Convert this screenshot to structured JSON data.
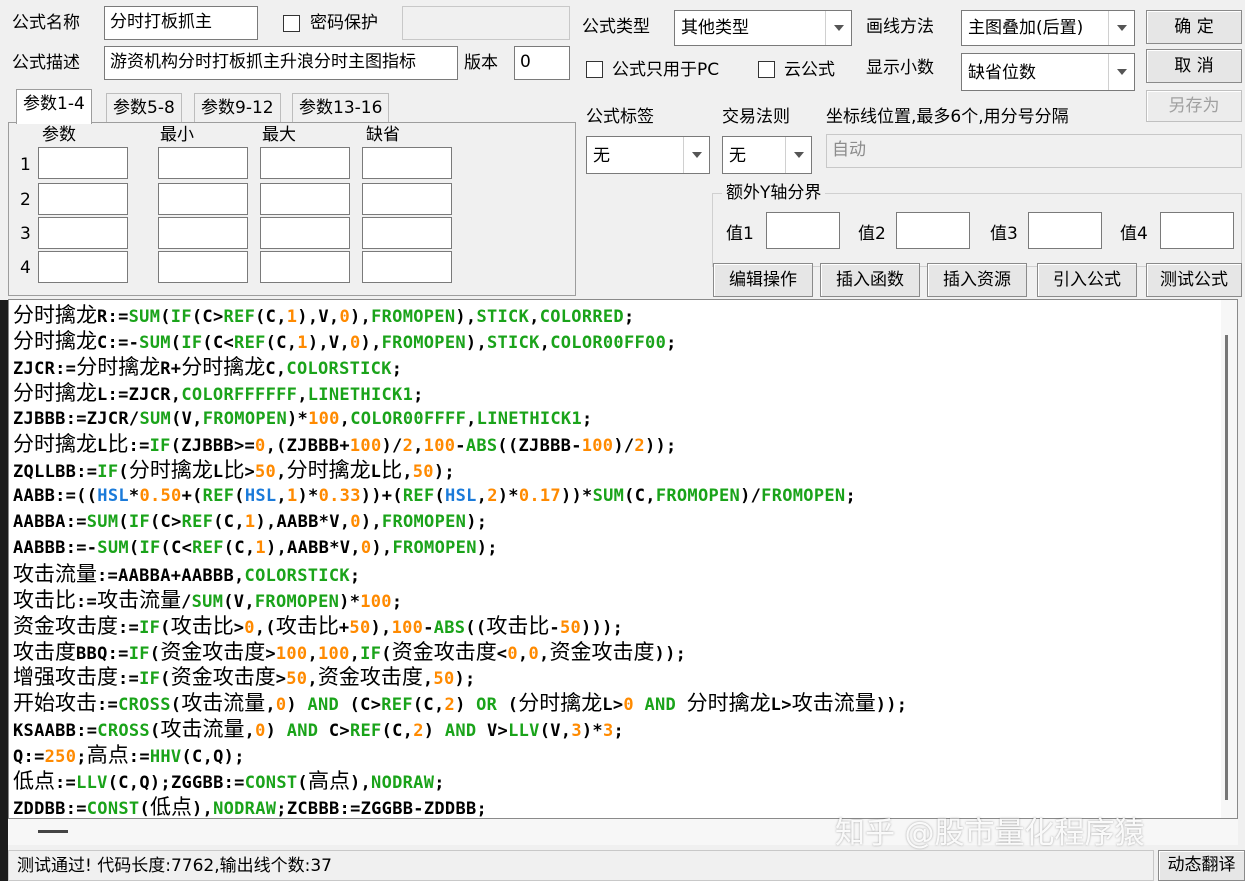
{
  "header": {
    "name_label": "公式名称",
    "name_value": "分时打板抓主",
    "password_label": "密码保护",
    "desc_label": "公式描述",
    "desc_value": "游资机构分时打板抓主升浪分时主图指标",
    "version_label": "版本",
    "version_value": "0",
    "type_label": "公式类型",
    "type_value": "其他类型",
    "draw_label": "画线方法",
    "draw_value": "主图叠加(后置)",
    "pc_only_label": "公式只用于PC",
    "cloud_label": "云公式",
    "decimals_label": "显示小数",
    "decimals_value": "缺省位数"
  },
  "buttons": {
    "ok": "确  定",
    "cancel": "取  消",
    "save_as": "另存为",
    "edit": "编辑操作",
    "insert_func": "插入函数",
    "insert_res": "插入资源",
    "import": "引入公式",
    "test": "测试公式",
    "dynamic_translate": "动态翻译"
  },
  "tabs": [
    "参数1-4",
    "参数5-8",
    "参数9-12",
    "参数13-16"
  ],
  "param_headers": [
    "参数",
    "最小",
    "最大",
    "缺省"
  ],
  "param_rows": [
    "1",
    "2",
    "3",
    "4"
  ],
  "tag": {
    "label": "公式标签",
    "value": "无"
  },
  "rule": {
    "label": "交易法则",
    "value": "无"
  },
  "coord": {
    "label": "坐标线位置,最多6个,用分号分隔",
    "placeholder": "自动"
  },
  "yaxis": {
    "label": "额外Y轴分界",
    "v1": "值1",
    "v2": "值2",
    "v3": "值3",
    "v4": "值4"
  },
  "code_lines": [
    "分时擒龙R:=SUM(IF(C>REF(C,1),V,0),FROMOPEN),STICK,COLORRED;",
    "分时擒龙C:=-SUM(IF(C<REF(C,1),V,0),FROMOPEN),STICK,COLOR00FF00;",
    "ZJCR:=分时擒龙R+分时擒龙C,COLORSTICK;",
    "分时擒龙L:=ZJCR,COLORFFFFFF,LINETHICK1;",
    "ZJBBB:=ZJCR/SUM(V,FROMOPEN)*100,COLOR00FFFF,LINETHICK1;",
    "分时擒龙L比:=IF(ZJBBB>=0,(ZJBBB+100)/2,100-ABS((ZJBBB-100)/2));",
    "ZQLLBB:=IF(分时擒龙L比>50,分时擒龙L比,50);",
    "AABB:=((HSL*0.50+(REF(HSL,1)*0.33))+(REF(HSL,2)*0.17))*SUM(C,FROMOPEN)/FROMOPEN;",
    "AABBA:=SUM(IF(C>REF(C,1),AABB*V,0),FROMOPEN);",
    "AABBB:=-SUM(IF(C<REF(C,1),AABB*V,0),FROMOPEN);",
    "攻击流量:=AABBA+AABBB,COLORSTICK;",
    "攻击比:=攻击流量/SUM(V,FROMOPEN)*100;",
    "资金攻击度:=IF(攻击比>0,(攻击比+50),100-ABS((攻击比-50)));",
    "攻击度BBQ:=IF(资金攻击度>100,100,IF(资金攻击度<0,0,资金攻击度));",
    "增强攻击度:=IF(资金攻击度>50,资金攻击度,50);",
    "开始攻击:=CROSS(攻击流量,0) AND (C>REF(C,2) OR (分时擒龙L>0 AND 分时擒龙L>攻击流量));",
    "KSAABB:=CROSS(攻击流量,0) AND C>REF(C,2) AND V>LLV(V,3)*3;",
    "Q:=250;高点:=HHV(C,Q);",
    "低点:=LLV(C,Q);ZGGBB:=CONST(高点),NODRAW;",
    "ZDDBB:=CONST(低点),NODRAW;ZCBBB:=ZGGBB-ZDDBB;"
  ],
  "status": "测试通过! 代码长度:7762,输出线个数:37",
  "watermark": "知乎 @股市量化程序猿"
}
